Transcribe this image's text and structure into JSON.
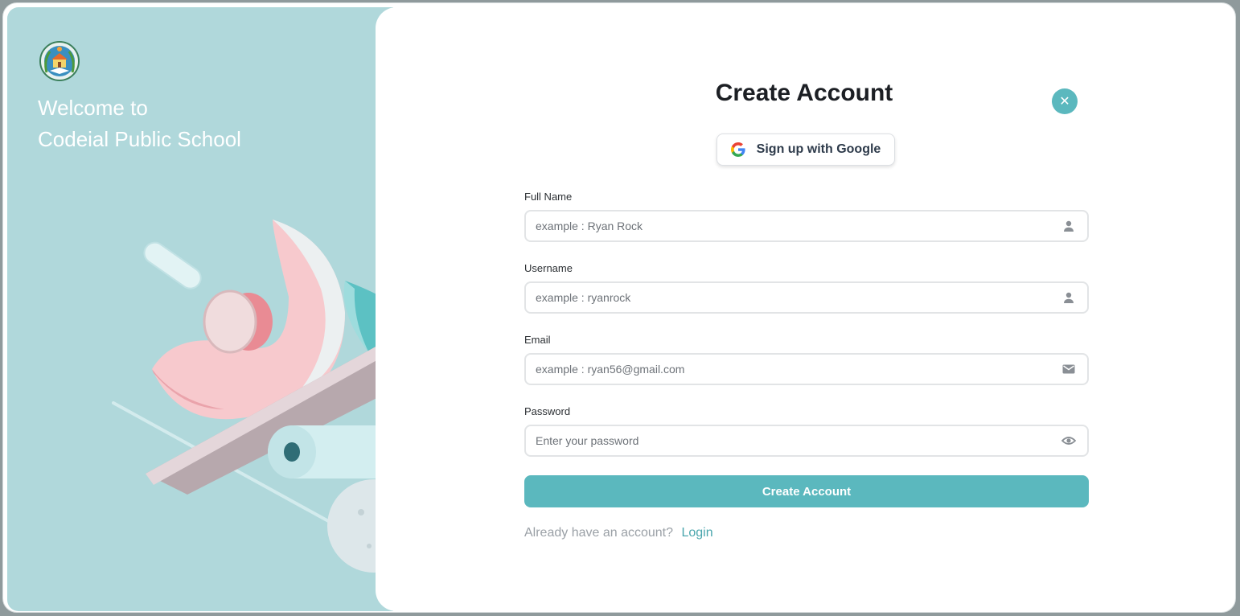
{
  "welcome": {
    "line1": "Welcome to",
    "line2": "Codeial Public School"
  },
  "form": {
    "title": "Create Account",
    "google_button": "Sign up with Google",
    "fields": [
      {
        "label": "Full Name",
        "placeholder": "example : Ryan Rock",
        "icon": "user-icon"
      },
      {
        "label": "Username",
        "placeholder": "example : ryanrock",
        "icon": "user-icon"
      },
      {
        "label": "Email",
        "placeholder": "example : ryan56@gmail.com",
        "icon": "mail-icon"
      },
      {
        "label": "Password",
        "placeholder": "Enter your password",
        "icon": "eye-icon"
      }
    ],
    "submit_label": "Create Account",
    "login_prompt": "Already have an account?",
    "login_link": "Login"
  },
  "colors": {
    "accent": "#5bb8be",
    "left_panel": "#b0d8db",
    "link": "#4aa6ad"
  }
}
